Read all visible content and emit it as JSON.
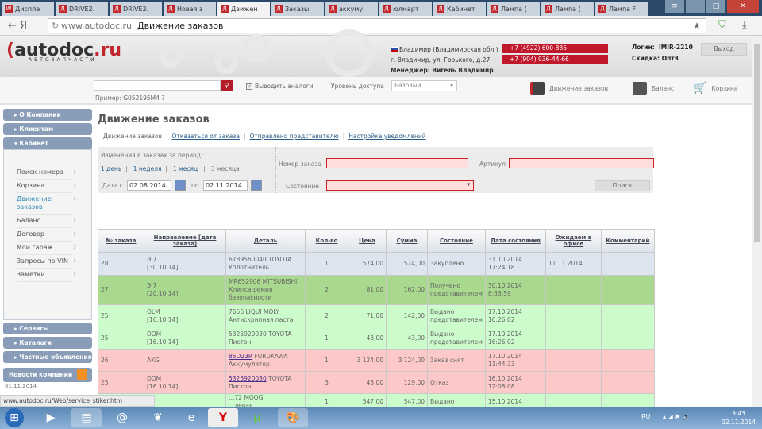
{
  "browser": {
    "tabs": [
      "Диспле",
      "DRIVE2.",
      "DRIVE2.",
      "Новая з",
      "Движен",
      "Заказы",
      "аккуму",
      "юлмарт",
      "Кабинет",
      "Лампа (",
      "Лампа (",
      "Лампа F"
    ],
    "active_tab": 4,
    "url_host": "www.autodoc.ru",
    "url_title": "Движение заказов"
  },
  "header": {
    "logo": "autodoc.ru",
    "logo_sub": "АВТОЗАПЧАСТИ",
    "region": "Владимир (Владимирская обл.)",
    "address": "г. Владимир, ул. Горького, д.27",
    "manager_label": "Менеджер:",
    "manager": "Вигель Владимир",
    "phones": [
      "+7 (4922) 600-885",
      "+7 (904) 036-44-66"
    ],
    "login_label": "Логин:",
    "login": "IMIR-2210",
    "discount_label": "Скидка:",
    "discount": "Опт3",
    "logout": "Выход"
  },
  "search": {
    "example_label": "Пример:",
    "example": "G052195M4",
    "analogs": "Выводить аналоги",
    "level_label": "Уровень доступа",
    "level": "Базовый",
    "orders_link": "Движение заказов",
    "balance_link": "Баланс",
    "cart_link": "Корзина"
  },
  "sidebar": {
    "company": "О Компании",
    "clients": "Клиентам",
    "cabinet": "Кабинет",
    "items": [
      "Поиск номера",
      "Корзина",
      "Движение заказов",
      "Баланс",
      "Договор",
      "Мой гараж",
      "Запросы по VIN",
      "Заметки"
    ],
    "services": "Сервисы",
    "catalogs": "Каталоги",
    "ads": "Частные объявления",
    "news": "Новости компании",
    "news_date": "01.11.2014"
  },
  "main": {
    "title": "Движение заказов",
    "subnav": [
      "Движение заказов",
      "Отказаться от заказа",
      "Отправлено представителю",
      "Настройка уведомлений"
    ],
    "filter": {
      "period_label": "Изменения в заказах за период:",
      "periods": [
        "1 день",
        "1 неделя",
        "1 месяц",
        "3 месяца"
      ],
      "date_from_label": "Дата с",
      "date_from": "02.08.2014",
      "date_to_label": "по",
      "date_to": "02.11.2014",
      "order_no_label": "Номер заказа",
      "article_label": "Артикул",
      "state_label": "Состояние",
      "search_btn": "Поиск"
    }
  },
  "table": {
    "headers": [
      "№ заказа",
      "Направление [дата заказа]",
      "Деталь",
      "Кол-во",
      "Цена",
      "Сумма",
      "Состояние",
      "Дата состояния",
      "Ожидаем в офисе",
      "Комментарий"
    ],
    "rows": [
      {
        "cls": "blue",
        "no": "28",
        "dir": "Э 7",
        "dir_date": "[30.10.14]",
        "code": "6789560040",
        "brand": "TOYOTA",
        "name": "Уплотнитель",
        "qty": "1",
        "price": "574,00",
        "sum": "574,00",
        "state": "Закуплено",
        "date": "31.10.2014",
        "time": "17:24:18",
        "expected": "11.11.2014",
        "comment": ""
      },
      {
        "cls": "dgreen",
        "no": "27",
        "dir": "Э 7",
        "dir_date": "[20.10.14]",
        "code": "MR652906",
        "brand": "MITSUBISHI",
        "name": "Клипса ремня безопасности",
        "qty": "2",
        "price": "81,00",
        "sum": "162,00",
        "state": "Получено представителем",
        "date": "30.10.2014",
        "time": "8:33:59",
        "expected": "",
        "comment": ""
      },
      {
        "cls": "green",
        "no": "25",
        "dir": "OLM",
        "dir_date": "[16.10.14]",
        "code": "7656",
        "brand": "LIQUI MOLY",
        "name": "Антискрипная паста",
        "qty": "2",
        "price": "71,00",
        "sum": "142,00",
        "state": "Выдано представителем",
        "date": "17.10.2014",
        "time": "16:26:02",
        "expected": "",
        "comment": ""
      },
      {
        "cls": "green",
        "no": "25",
        "dir": "DOM",
        "dir_date": "[16.10.14]",
        "code": "5325920030",
        "brand": "TOYOTA",
        "name": "Пистон",
        "qty": "1",
        "price": "43,00",
        "sum": "43,00",
        "state": "Выдано представителем",
        "date": "17.10.2014",
        "time": "16:26:02",
        "expected": "",
        "comment": ""
      },
      {
        "cls": "red",
        "no": "26",
        "dir": "AKG",
        "dir_date": "",
        "code": "85D23R",
        "brand": "FURUKAWA",
        "name": "Аккумулятор",
        "qty": "1",
        "price": "3 124,00",
        "sum": "3 124,00",
        "state": "Заказ снят",
        "date": "17.10.2014",
        "time": "11:44:33",
        "expected": "",
        "comment": "",
        "link": true
      },
      {
        "cls": "red",
        "no": "25",
        "dir": "DOM",
        "dir_date": "[16.10.14]",
        "code": "5325920030",
        "brand": "TOYOTA",
        "name": "Пистон",
        "qty": "3",
        "price": "43,00",
        "sum": "129,00",
        "state": "Отказ",
        "date": "16.10.2014",
        "time": "12:08:08",
        "expected": "",
        "comment": "",
        "link": true
      },
      {
        "cls": "green",
        "no": "",
        "dir": "",
        "dir_date": "",
        "code": "…72",
        "brand": "MOOG",
        "name": "…левая",
        "qty": "1",
        "price": "547,00",
        "sum": "547,00",
        "state": "Выдано",
        "date": "15.10.2014",
        "time": "",
        "expected": "",
        "comment": ""
      }
    ]
  },
  "status_bar": "www.autodoc.ru/Web/service_stiker.htm",
  "taskbar": {
    "lang": "RU",
    "time": "9:43",
    "date": "02.11.2014"
  }
}
